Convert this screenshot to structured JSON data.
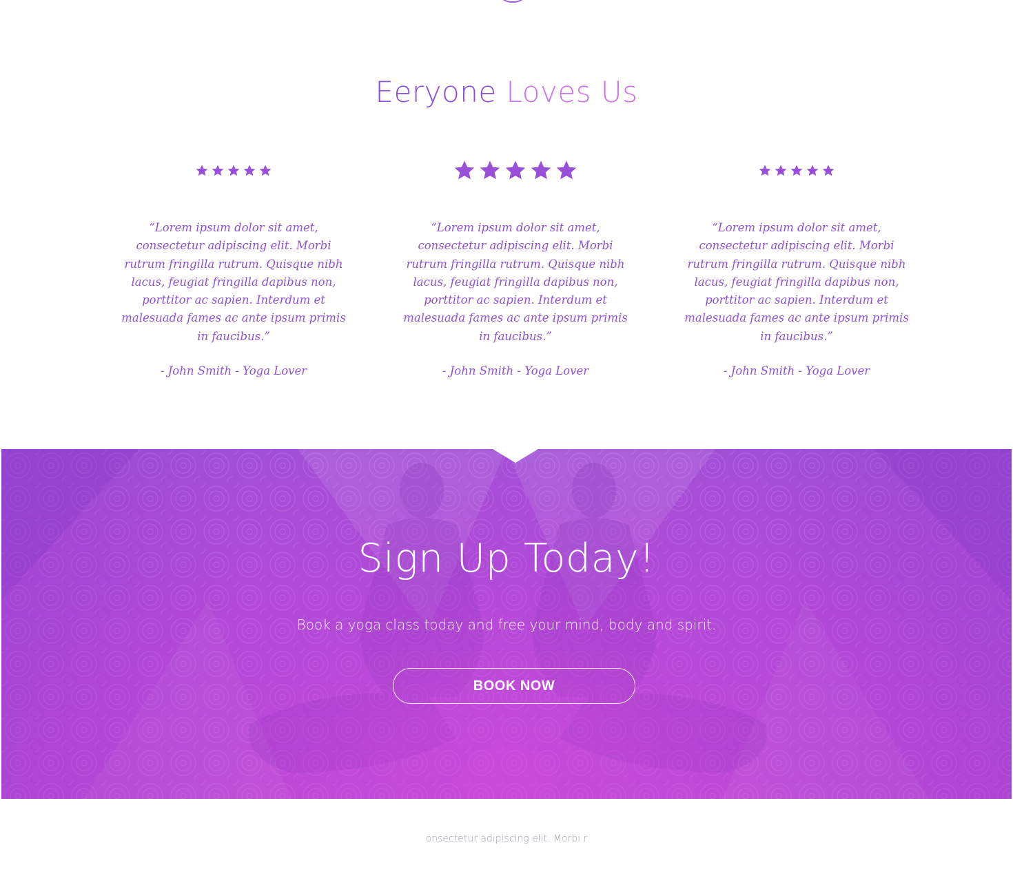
{
  "testimonials": {
    "title_part1": "Eeryone",
    "title_part2": "Loves Us",
    "star_color": "#9a4fd8",
    "items": [
      {
        "rating": 5,
        "quote": "“Lorem ipsum dolor sit amet, consectetur adipiscing elit. Morbi rutrum fringilla rutrum. Quisque nibh lacus, feugiat fringilla dapibus non, porttitor ac sapien. Interdum et malesuada fames ac ante ipsum primis in faucibus.”",
        "author": "- John Smith - Yoga Lover"
      },
      {
        "rating": 5,
        "quote": "“Lorem ipsum dolor sit amet, consectetur adipiscing elit. Morbi rutrum fringilla rutrum. Quisque nibh lacus, feugiat fringilla dapibus non, porttitor ac sapien. Interdum et malesuada fames ac ante ipsum primis in faucibus.”",
        "author": "- John Smith - Yoga Lover"
      },
      {
        "rating": 5,
        "quote": "“Lorem ipsum dolor sit amet, consectetur adipiscing elit. Morbi rutrum fringilla rutrum. Quisque nibh lacus, feugiat fringilla dapibus non, porttitor ac sapien. Interdum et malesuada fames ac ante ipsum primis in faucibus.”",
        "author": "- John Smith - Yoga Lover"
      }
    ]
  },
  "signup": {
    "title": "Sign Up Today!",
    "subtitle": "Book a yoga class today and free your mind, body and spirit.",
    "button_label": "BOOK NOW",
    "accent_color": "#b44bd8"
  },
  "footer": {
    "snippet": "onsectetur adipiscing elit. Morbi r"
  },
  "colors": {
    "title_primary": "#8a4fd9",
    "title_secondary": "#cd73e9",
    "testimonial_text": "#8d52d6"
  }
}
